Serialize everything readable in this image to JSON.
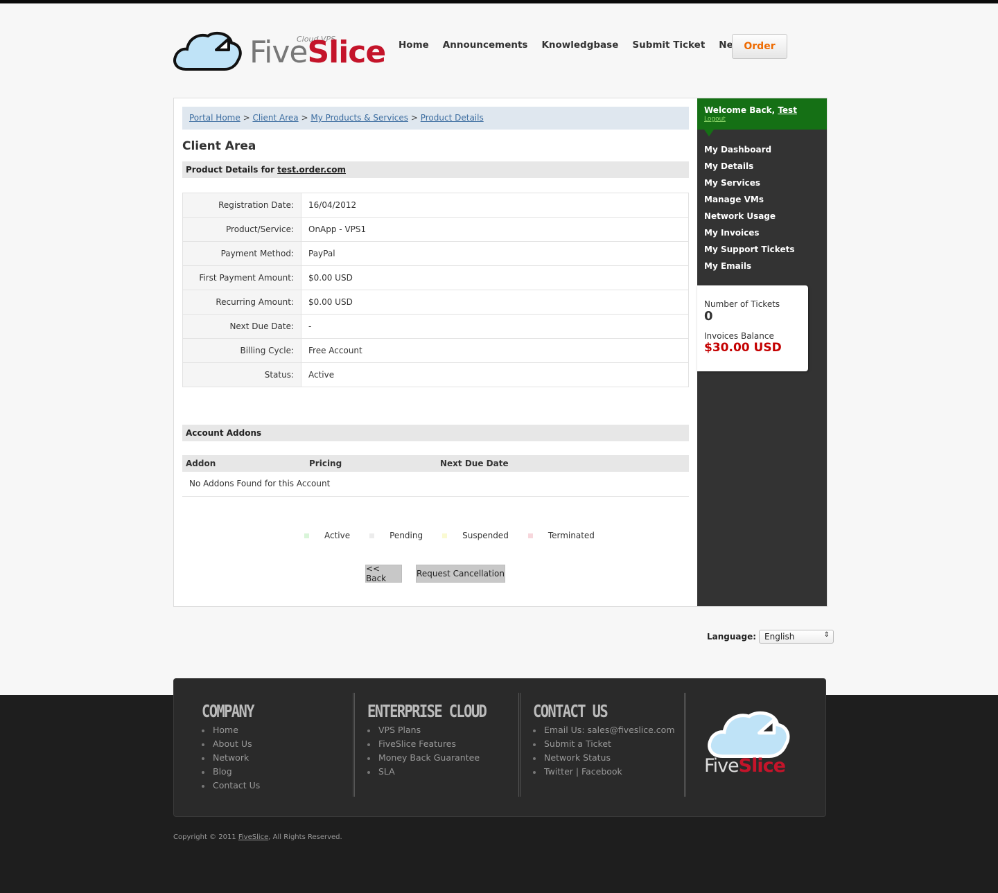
{
  "brand": {
    "tagline": "Cloud VPS",
    "name_part1": "Five",
    "name_part2": "Slice"
  },
  "nav": [
    "Home",
    "Announcements",
    "Knowledgbase",
    "Submit Ticket",
    "Network"
  ],
  "order_label": "Order",
  "breadcrumb": {
    "items": [
      "Portal Home",
      "Client Area",
      "My Products & Services",
      "Product Details"
    ],
    "separator": ">"
  },
  "page_title": "Client Area",
  "product": {
    "heading_prefix": "Product Details for",
    "domain": "test.order.com",
    "rows": [
      {
        "label": "Registration Date:",
        "value": "16/04/2012"
      },
      {
        "label": "Product/Service:",
        "value": "OnApp - VPS1"
      },
      {
        "label": "Payment Method:",
        "value": "PayPal"
      },
      {
        "label": "First Payment Amount:",
        "value": "$0.00 USD"
      },
      {
        "label": "Recurring Amount:",
        "value": "$0.00 USD"
      },
      {
        "label": "Next Due Date:",
        "value": "-"
      },
      {
        "label": "Billing Cycle:",
        "value": "Free Account"
      },
      {
        "label": "Status:",
        "value": "Active"
      }
    ]
  },
  "addons": {
    "heading": "Account Addons",
    "columns": [
      "Addon",
      "Pricing",
      "Next Due Date"
    ],
    "empty_text": "No Addons Found for this Account"
  },
  "legend": [
    {
      "label": "Active",
      "color": "#d9f5d9"
    },
    {
      "label": "Pending",
      "color": "#ececec"
    },
    {
      "label": "Suspended",
      "color": "#fafad2"
    },
    {
      "label": "Terminated",
      "color": "#f7d7dc"
    }
  ],
  "buttons": {
    "back": "<< Back",
    "cancel": "Request Cancellation"
  },
  "sidebar": {
    "welcome": "Welcome Back,",
    "user": "Test",
    "logout": "Logout",
    "menu": [
      "My Dashboard",
      "My Details",
      "My Services",
      "Manage VMs",
      "Network Usage",
      "My Invoices",
      "My Support Tickets",
      "My Emails"
    ],
    "tickets_label": "Number of Tickets",
    "tickets_value": "0",
    "balance_label": "Invoices Balance",
    "balance_value": "$30.00 USD"
  },
  "language": {
    "label": "Language:",
    "value": "English"
  },
  "footer": {
    "columns": [
      {
        "title": "COMPANY",
        "items": [
          "Home",
          "About Us",
          "Network",
          "Blog",
          "Contact Us"
        ]
      },
      {
        "title": "ENTERPRISE CLOUD",
        "items": [
          "VPS Plans",
          "FiveSlice Features",
          "Money Back Guarantee",
          "SLA"
        ]
      },
      {
        "title": "CONTACT US",
        "items": [
          "Email Us: sales@fiveslice.com",
          "Submit a Ticket",
          "Network Status",
          "Twitter | Facebook"
        ]
      }
    ],
    "copyright_prefix": "Copyright © 2011",
    "copyright_link": "FiveSlice",
    "copyright_suffix": ", All Rights Reserved."
  },
  "colors": {
    "accent_green": "#157015",
    "balance_red": "#c40000",
    "order_orange": "#ee6a00",
    "brand_red": "#c4142a"
  }
}
